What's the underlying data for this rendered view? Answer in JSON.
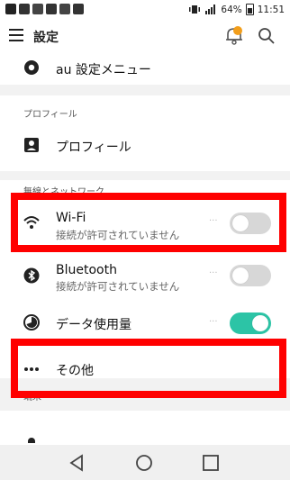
{
  "status_bar": {
    "battery": "64%",
    "time": "11:51",
    "left_icons": [
      "notification-icon",
      "gallery-icon",
      "tools-icon",
      "vpn-icon",
      "calendar-icon",
      "message-icon"
    ]
  },
  "app_bar": {
    "title": "設定",
    "menu_icon": "hamburger-icon",
    "notification_badge_color": "#f29e1b",
    "search_icon": "search-icon"
  },
  "settings": {
    "au_item_label": "au 設定メニュー",
    "profile_section": "プロフィール",
    "profile_item_label": "プロフィール",
    "network_section": "無線とネットワーク",
    "wifi": {
      "label": "Wi‑Fi",
      "sub": "接続が許可されていません",
      "enabled": false
    },
    "bluetooth": {
      "label": "Bluetooth",
      "sub": "接続が許可されていません",
      "enabled": false
    },
    "data_usage": {
      "label": "データ使用量",
      "enabled": true
    },
    "other": {
      "label": "その他"
    },
    "terminal_section": "端末"
  },
  "colors": {
    "highlight": "#ff0000",
    "toggle_on": "#2cc4a6",
    "toggle_off": "#d7d7d7"
  }
}
